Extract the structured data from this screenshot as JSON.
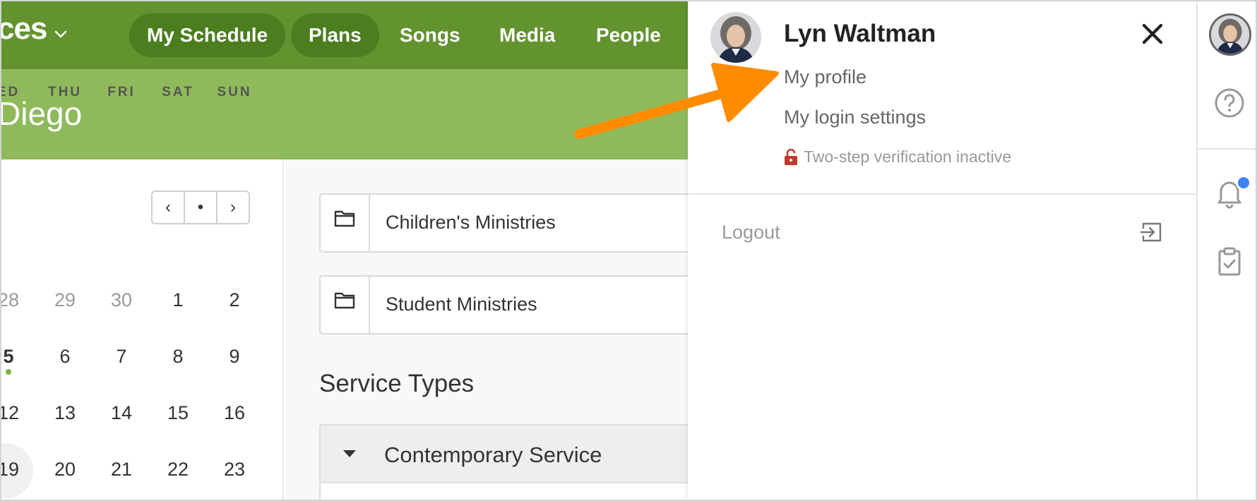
{
  "topnav": {
    "app_name": "ces",
    "tabs": [
      {
        "label": "My Schedule"
      },
      {
        "label": "Plans"
      },
      {
        "label": "Songs"
      },
      {
        "label": "Media"
      },
      {
        "label": "People"
      }
    ],
    "bg_color": "#62932f",
    "active_pill_color": "#4c7d1f"
  },
  "banner": {
    "title": "Diego",
    "bg_color": "#8fba5c"
  },
  "calendar": {
    "nav": {
      "prev": "‹",
      "today": "•",
      "next": "›"
    },
    "weekdays": [
      "ED",
      "THU",
      "FRI",
      "SAT",
      "SUN"
    ],
    "weeks": [
      [
        "28",
        "29",
        "30",
        "1",
        "2"
      ],
      [
        "5",
        "6",
        "7",
        "8",
        "9"
      ],
      [
        "12",
        "13",
        "14",
        "15",
        "16"
      ],
      [
        "19",
        "20",
        "21",
        "22",
        "23"
      ]
    ],
    "today_dot_color": "#7cb342"
  },
  "main": {
    "folders": [
      {
        "label": "Children's Ministries",
        "icon": "folder-icon"
      },
      {
        "label": "Student Ministries",
        "icon": "folder-icon"
      }
    ],
    "section_title": "Service Types",
    "service_types": [
      {
        "label": "Contemporary Service"
      }
    ]
  },
  "panel": {
    "user_name": "Lyn Waltman",
    "links": {
      "profile": "My profile",
      "login_settings": "My login settings"
    },
    "two_step": {
      "text": "Two-step verification inactive",
      "icon": "unlocked-padlock-icon",
      "icon_color": "#c0392b"
    },
    "logout": "Logout"
  },
  "rail": {
    "icons": [
      "avatar",
      "help-icon",
      "bell-icon",
      "clipboard-check-icon"
    ],
    "notification_color": "#3b82f6"
  },
  "annotation": {
    "arrow_color": "#ff8c00",
    "arrow_points_to": "My profile"
  }
}
